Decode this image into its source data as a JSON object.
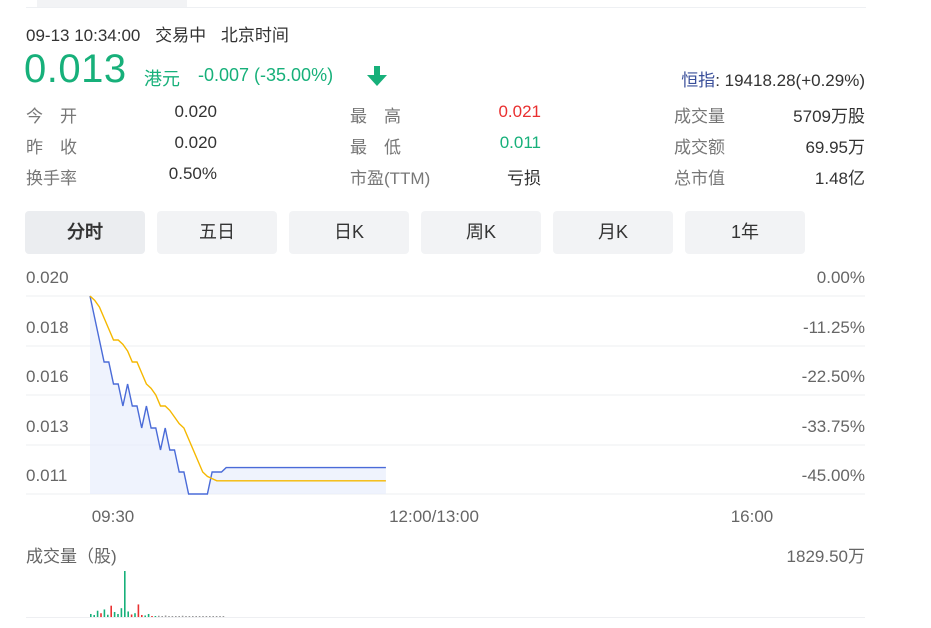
{
  "header": {
    "datetime": "09-13 10:34:00",
    "trade_status": "交易中",
    "timezone": "北京时间"
  },
  "quote": {
    "price": "0.013",
    "currency": "港元",
    "change": "-0.007 (-35.00%)",
    "direction_icon": "arrow-down-icon",
    "up_color": "#e93030",
    "down_color": "#17b07a"
  },
  "index": {
    "label": "恒指",
    "value": ": 19418.28(+0.29%)"
  },
  "stats": [
    {
      "label": "今　开",
      "value": "0.020",
      "tone": ""
    },
    {
      "label": "最　高",
      "value": "0.021",
      "tone": "red"
    },
    {
      "label": "成交量",
      "value": "5709万股",
      "tone": ""
    },
    {
      "label": "昨　收",
      "value": "0.020",
      "tone": ""
    },
    {
      "label": "最　低",
      "value": "0.011",
      "tone": "green"
    },
    {
      "label": "成交额",
      "value": "69.95万",
      "tone": ""
    },
    {
      "label": "换手率",
      "value": "0.50%",
      "tone": ""
    },
    {
      "label": "市盈(TTM)",
      "value": "亏损",
      "tone": ""
    },
    {
      "label": "总市值",
      "value": "1.48亿",
      "tone": ""
    }
  ],
  "tabs": [
    {
      "label": "分时",
      "active": true
    },
    {
      "label": "五日",
      "active": false
    },
    {
      "label": "日K",
      "active": false
    },
    {
      "label": "周K",
      "active": false
    },
    {
      "label": "月K",
      "active": false
    },
    {
      "label": "1年",
      "active": false
    }
  ],
  "chart_data": {
    "type": "line",
    "y_left_ticks": [
      "0.020",
      "0.018",
      "0.016",
      "0.013",
      "0.011"
    ],
    "y_right_ticks": [
      "0.00%",
      "-11.25%",
      "-22.50%",
      "-33.75%",
      "-45.00%"
    ],
    "x_ticks": [
      "09:30",
      "12:00/13:00",
      "16:00"
    ],
    "ylim": [
      0.011,
      0.02
    ],
    "session_minutes": 330,
    "minutes_elapsed": 64,
    "series": [
      {
        "color": "#4a6bd8",
        "values": [
          0.02,
          0.019,
          0.018,
          0.017,
          0.017,
          0.016,
          0.016,
          0.015,
          0.016,
          0.015,
          0.015,
          0.014,
          0.015,
          0.014,
          0.014,
          0.013,
          0.014,
          0.013,
          0.013,
          0.012,
          0.012,
          0.011,
          0.011,
          0.011,
          0.011,
          0.011,
          0.012,
          0.012,
          0.012,
          0.0122,
          0.0122,
          0.0122,
          0.0122,
          0.0122,
          0.0122,
          0.0122,
          0.0122,
          0.0122,
          0.0122,
          0.0122,
          0.0122,
          0.0122,
          0.0122,
          0.0122,
          0.0122,
          0.0122,
          0.0122,
          0.0122,
          0.0122,
          0.0122,
          0.0122,
          0.0122,
          0.0122,
          0.0122,
          0.0122,
          0.0122,
          0.0122,
          0.0122,
          0.0122,
          0.0122,
          0.0122,
          0.0122,
          0.0122,
          0.0122
        ]
      },
      {
        "color": "#f5b800",
        "values": [
          0.02,
          0.0198,
          0.0195,
          0.019,
          0.0185,
          0.018,
          0.018,
          0.0178,
          0.0175,
          0.017,
          0.017,
          0.0165,
          0.016,
          0.0158,
          0.0155,
          0.015,
          0.015,
          0.0148,
          0.0145,
          0.0142,
          0.014,
          0.0135,
          0.013,
          0.0125,
          0.012,
          0.0118,
          0.0117,
          0.0116,
          0.0116,
          0.0116,
          0.0116,
          0.0116,
          0.0116,
          0.0116,
          0.0116,
          0.0116,
          0.0116,
          0.0116,
          0.0116,
          0.0116,
          0.0116,
          0.0116,
          0.0116,
          0.0116,
          0.0116,
          0.0116,
          0.0116,
          0.0116,
          0.0116,
          0.0116,
          0.0116,
          0.0116,
          0.0116,
          0.0116,
          0.0116,
          0.0116,
          0.0116,
          0.0116,
          0.0116,
          0.0116,
          0.0116,
          0.0116,
          0.0116,
          0.0116
        ]
      }
    ]
  },
  "volume": {
    "label": "成交量（股)",
    "max_label": "1829.50万",
    "chart_data": {
      "type": "bar",
      "max": 18295000,
      "values": [
        1200000,
        800000,
        2500000,
        1500000,
        3000000,
        900000,
        4500000,
        2000000,
        1200000,
        3500000,
        18295000,
        2200000,
        1000000,
        1500000,
        5000000,
        800000,
        600000,
        1200000,
        400000,
        300000,
        500000,
        200000,
        600000,
        300000,
        400000,
        200000,
        300000,
        500000,
        200000,
        300000,
        200000,
        400000,
        200000,
        300000,
        200000,
        100000,
        200000,
        300000,
        100000,
        200000
      ],
      "colors": [
        "#17b07a",
        "#17b07a",
        "#17b07a",
        "#e93030",
        "#17b07a",
        "#17b07a",
        "#e93030",
        "#17b07a",
        "#17b07a",
        "#17b07a",
        "#17b07a",
        "#17b07a",
        "#e93030",
        "#17b07a",
        "#e93030",
        "#e93030",
        "#17b07a",
        "#17b07a",
        "#e93030",
        "#17b07a",
        "#999999",
        "#999999",
        "#999999",
        "#999999",
        "#999999",
        "#999999",
        "#999999",
        "#999999",
        "#999999",
        "#999999",
        "#999999",
        "#999999",
        "#999999",
        "#999999",
        "#999999",
        "#999999",
        "#999999",
        "#999999",
        "#999999",
        "#999999"
      ]
    }
  }
}
